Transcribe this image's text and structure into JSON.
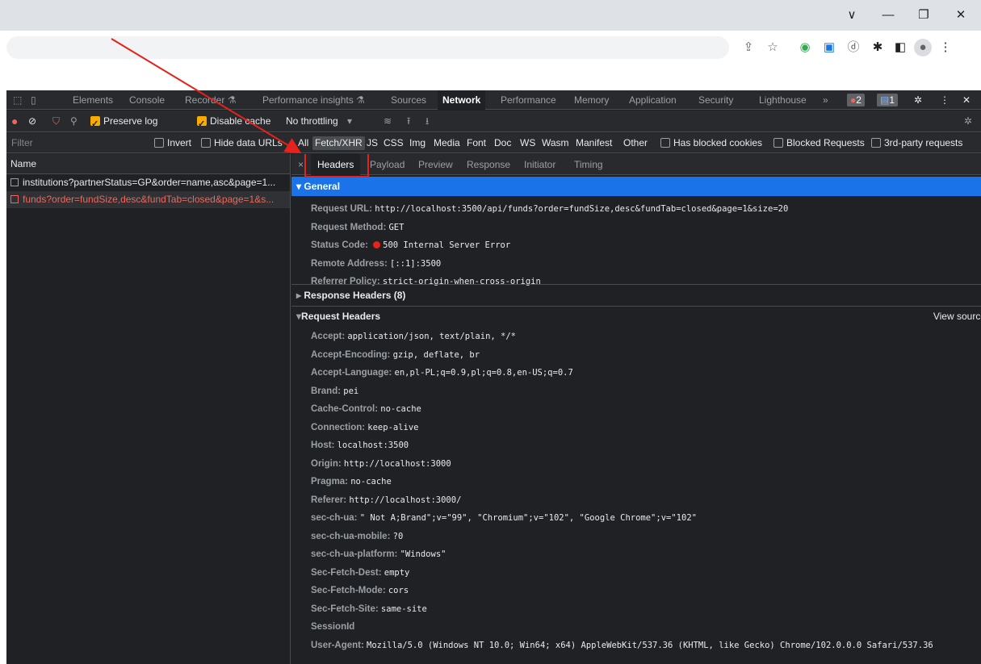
{
  "window": {
    "controls": {
      "minimize_more": "∨",
      "minimize": "—",
      "restore": "❐",
      "close": "✕"
    }
  },
  "toolbar_icons": [
    "share-icon",
    "star-icon",
    "extension-color-icon",
    "extension-screen-icon",
    "extension-d-icon",
    "puzzle-icon",
    "sidepanel-icon",
    "profile-icon",
    "menu-icon"
  ],
  "devtools": {
    "tabs": [
      {
        "label": "Elements"
      },
      {
        "label": "Console"
      },
      {
        "label": "Recorder ⚗"
      },
      {
        "label": "Performance insights ⚗"
      },
      {
        "label": "Sources"
      },
      {
        "label": "Network",
        "active": true
      },
      {
        "label": "Performance"
      },
      {
        "label": "Memory"
      },
      {
        "label": "Application"
      },
      {
        "label": "Security"
      },
      {
        "label": "Lighthouse"
      },
      {
        "label": "»"
      }
    ],
    "badges": {
      "errors": "2",
      "messages": "1"
    },
    "toolbar": {
      "preserve_log": "Preserve log",
      "disable_cache": "Disable cache",
      "throttling": "No throttling"
    },
    "filter": {
      "placeholder": "Filter",
      "invert": "Invert",
      "hide_data_urls": "Hide data URLs",
      "types": [
        "All",
        "Fetch/XHR",
        "JS",
        "CSS",
        "Img",
        "Media",
        "Font",
        "Doc",
        "WS",
        "Wasm",
        "Manifest",
        "Other"
      ],
      "selected_type": "Fetch/XHR",
      "has_blocked_cookies": "Has blocked cookies",
      "blocked_requests": "Blocked Requests",
      "third_party": "3rd-party requests"
    },
    "request_list": {
      "header": "Name",
      "rows": [
        {
          "name": "institutions?partnerStatus=GP&order=name,asc&page=1...",
          "error": false
        },
        {
          "name": "funds?order=fundSize,desc&fundTab=closed&page=1&s...",
          "error": true
        }
      ]
    },
    "detail": {
      "close": "×",
      "tabs": [
        "Headers",
        "Payload",
        "Preview",
        "Response",
        "Initiator",
        "Timing"
      ],
      "active_tab": "Headers",
      "general": {
        "title": "General",
        "rows": [
          {
            "k": "Request URL:",
            "v": "http://localhost:3500/api/funds?order=fundSize,desc&fundTab=closed&page=1&size=20"
          },
          {
            "k": "Request Method:",
            "v": "GET"
          },
          {
            "k": "Status Code:",
            "v": "500 Internal Server Error"
          },
          {
            "k": "Remote Address:",
            "v": "[::1]:3500"
          },
          {
            "k": "Referrer Policy:",
            "v": "strict-origin-when-cross-origin"
          }
        ]
      },
      "response_headers": "Response Headers (8)",
      "request_headers": {
        "title": "Request Headers",
        "view_source": "View source",
        "rows": [
          {
            "k": "Accept:",
            "v": "application/json, text/plain, */*"
          },
          {
            "k": "Accept-Encoding:",
            "v": "gzip, deflate, br"
          },
          {
            "k": "Accept-Language:",
            "v": "en,pl-PL;q=0.9,pl;q=0.8,en-US;q=0.7"
          },
          {
            "k": "Brand:",
            "v": "pei"
          },
          {
            "k": "Cache-Control:",
            "v": "no-cache"
          },
          {
            "k": "Connection:",
            "v": "keep-alive"
          },
          {
            "k": "Host:",
            "v": "localhost:3500"
          },
          {
            "k": "Origin:",
            "v": "http://localhost:3000"
          },
          {
            "k": "Pragma:",
            "v": "no-cache"
          },
          {
            "k": "Referer:",
            "v": "http://localhost:3000/"
          },
          {
            "k": "sec-ch-ua:",
            "v": "\" Not A;Brand\";v=\"99\", \"Chromium\";v=\"102\", \"Google Chrome\";v=\"102\""
          },
          {
            "k": "sec-ch-ua-mobile:",
            "v": "?0"
          },
          {
            "k": "sec-ch-ua-platform:",
            "v": "\"Windows\""
          },
          {
            "k": "Sec-Fetch-Dest:",
            "v": "empty"
          },
          {
            "k": "Sec-Fetch-Mode:",
            "v": "cors"
          },
          {
            "k": "Sec-Fetch-Site:",
            "v": "same-site"
          },
          {
            "k": "SessionId",
            "v": ""
          },
          {
            "k": "User-Agent:",
            "v": "Mozilla/5.0 (Windows NT 10.0; Win64; x64) AppleWebKit/537.36 (KHTML, like Gecko) Chrome/102.0.0.0 Safari/537.36"
          }
        ]
      }
    }
  },
  "colors": {
    "accent": "#1a73e8",
    "error": "#ee675c",
    "annotation": "#e5221b",
    "checkbox": "#f9ab00"
  }
}
